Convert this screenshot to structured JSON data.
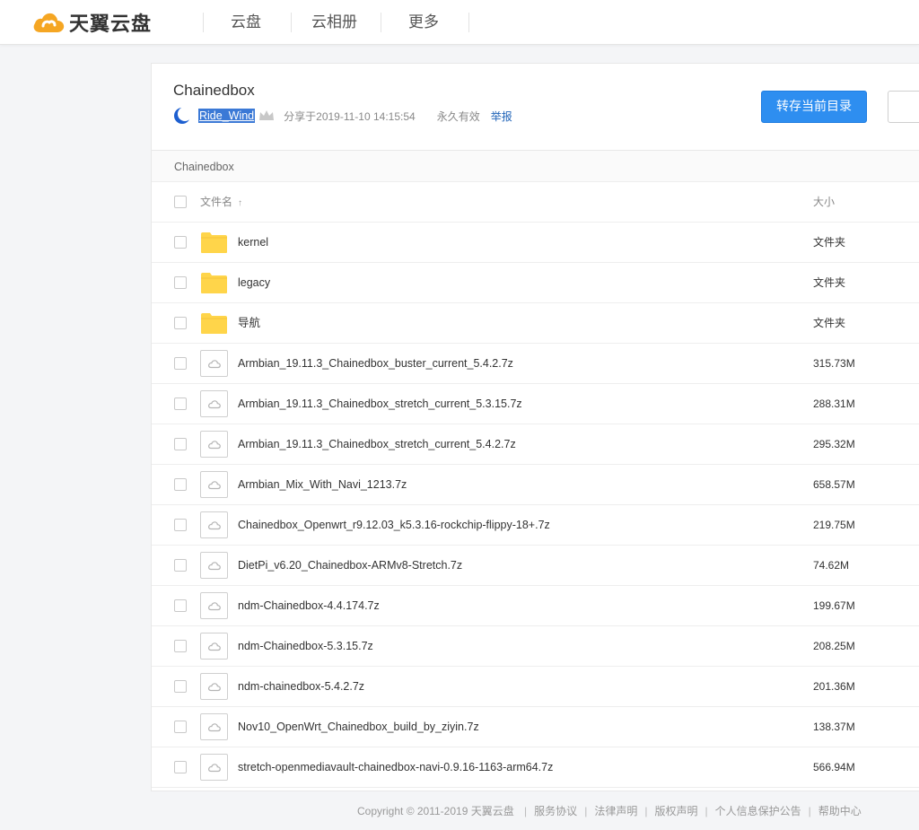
{
  "brand": {
    "name": "天翼云盘",
    "accent": "#f5a623"
  },
  "nav": {
    "items": [
      "云盘",
      "云相册",
      "更多"
    ]
  },
  "share": {
    "title": "Chainedbox",
    "username": "Ride_Wind",
    "shared_at": "分享于2019-11-10 14:15:54",
    "validity": "永久有效",
    "report": "举报",
    "save_button": "转存当前目录"
  },
  "breadcrumb": "Chainedbox",
  "list": {
    "headers": {
      "name": "文件名",
      "sort_arrow": "↑",
      "size": "大小"
    },
    "rows": [
      {
        "type": "folder",
        "name": "kernel",
        "size": "文件夹"
      },
      {
        "type": "folder",
        "name": "legacy",
        "size": "文件夹"
      },
      {
        "type": "folder",
        "name": "导航",
        "size": "文件夹"
      },
      {
        "type": "file",
        "name": "Armbian_19.11.3_Chainedbox_buster_current_5.4.2.7z",
        "size": "315.73M"
      },
      {
        "type": "file",
        "name": "Armbian_19.11.3_Chainedbox_stretch_current_5.3.15.7z",
        "size": "288.31M"
      },
      {
        "type": "file",
        "name": "Armbian_19.11.3_Chainedbox_stretch_current_5.4.2.7z",
        "size": "295.32M"
      },
      {
        "type": "file",
        "name": "Armbian_Mix_With_Navi_1213.7z",
        "size": "658.57M"
      },
      {
        "type": "file",
        "name": "Chainedbox_Openwrt_r9.12.03_k5.3.16-rockchip-flippy-18+.7z",
        "size": "219.75M"
      },
      {
        "type": "file",
        "name": "DietPi_v6.20_Chainedbox-ARMv8-Stretch.7z",
        "size": "74.62M"
      },
      {
        "type": "file",
        "name": "ndm-Chainedbox-4.4.174.7z",
        "size": "199.67M"
      },
      {
        "type": "file",
        "name": "ndm-Chainedbox-5.3.15.7z",
        "size": "208.25M"
      },
      {
        "type": "file",
        "name": "ndm-chainedbox-5.4.2.7z",
        "size": "201.36M"
      },
      {
        "type": "file",
        "name": "Nov10_OpenWrt_Chainedbox_build_by_ziyin.7z",
        "size": "138.37M"
      },
      {
        "type": "file",
        "name": "stretch-openmediavault-chainedbox-navi-0.9.16-1163-arm64.7z",
        "size": "566.94M"
      }
    ]
  },
  "footer": {
    "copyright": "Copyright © 2011-2019 天翼云盘",
    "links": [
      "服务协议",
      "法律声明",
      "版权声明",
      "个人信息保护公告",
      "帮助中心"
    ],
    "separator": "|"
  },
  "colors": {
    "primary": "#2e8ef0",
    "folder": "#ffd54a",
    "link": "#1f63b8"
  }
}
